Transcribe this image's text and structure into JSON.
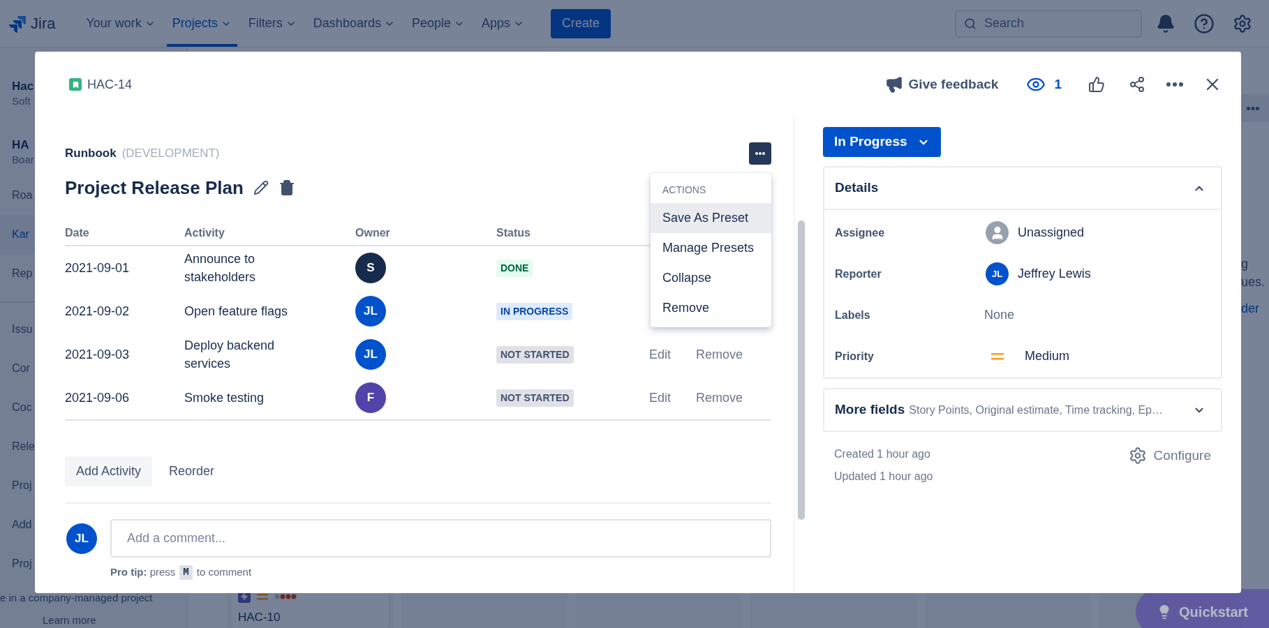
{
  "nav": {
    "logo": "Jira",
    "items": [
      {
        "label": "Your work",
        "selected": false
      },
      {
        "label": "Projects",
        "selected": true
      },
      {
        "label": "Filters",
        "selected": false
      },
      {
        "label": "Dashboards",
        "selected": false
      },
      {
        "label": "People",
        "selected": false
      },
      {
        "label": "Apps",
        "selected": false
      }
    ],
    "create": "Create",
    "search": {
      "placeholder": "Search"
    }
  },
  "sidebar": {
    "project": {
      "name": "Hac",
      "type": "Soft"
    },
    "board": {
      "name": "HA",
      "type": "Boar"
    },
    "items": [
      {
        "label": "Roa",
        "selected": false
      },
      {
        "label": "Kar",
        "selected": true
      },
      {
        "label": "Rep",
        "selected": false
      }
    ],
    "more_items": [
      "Issu",
      "Cor",
      "Coc",
      "Rele",
      "Proj",
      "Add",
      "Proj"
    ],
    "footer": "e in a company-managed project",
    "learn_more": "Learn more"
  },
  "board": {
    "card_key": "HAC-10",
    "right_texts": [
      "g",
      "ues."
    ],
    "right_link": "der"
  },
  "quickstart": "Quickstart",
  "issue": {
    "key": "HAC-14",
    "feedback": "Give feedback",
    "watchers": "1",
    "runbook": {
      "label": "Runbook",
      "environment": "(DEVELOPMENT)",
      "title": "Project Release Plan",
      "columns": [
        "Date",
        "Activity",
        "Owner",
        "Status"
      ],
      "rows": [
        {
          "date": "2021-09-01",
          "activity": "Announce to stakeholders",
          "owner": {
            "initials": "S",
            "color": "#172b4d"
          },
          "status": {
            "label": "DONE",
            "kind": "done"
          }
        },
        {
          "date": "2021-09-02",
          "activity": "Open feature flags",
          "owner": {
            "initials": "JL",
            "color": "#0052cc"
          },
          "status": {
            "label": "IN PROGRESS",
            "kind": "in_progress"
          }
        },
        {
          "date": "2021-09-03",
          "activity": "Deploy backend services",
          "owner": {
            "initials": "JL",
            "color": "#0052cc"
          },
          "status": {
            "label": "NOT STARTED",
            "kind": "not_started"
          },
          "actions": [
            "Edit",
            "Remove"
          ]
        },
        {
          "date": "2021-09-06",
          "activity": "Smoke testing",
          "owner": {
            "initials": "F",
            "color": "#5243aa"
          },
          "status": {
            "label": "NOT STARTED",
            "kind": "not_started"
          },
          "actions": [
            "Edit",
            "Remove"
          ]
        }
      ],
      "menu": {
        "heading": "ACTIONS",
        "items": [
          {
            "label": "Save As Preset",
            "selected": true
          },
          {
            "label": "Manage Presets",
            "selected": false
          },
          {
            "label": "Collapse",
            "selected": false
          },
          {
            "label": "Remove",
            "selected": false
          }
        ]
      },
      "buttons": [
        "Add Activity",
        "Reorder"
      ]
    },
    "comment": {
      "initials": "JL",
      "placeholder": "Add a comment...",
      "tip": "**Pro tip:** press",
      "key": "M",
      "tip_after": "to comment"
    },
    "status_button": "In Progress",
    "details": {
      "title": "Details",
      "expanded": true,
      "fields": [
        {
          "label": "Assignee",
          "value": "Unassigned",
          "kind": "unassigned"
        },
        {
          "label": "Reporter",
          "value": "Jeffrey Lewis",
          "kind": "user",
          "initials": "JL"
        },
        {
          "label": "Labels",
          "value": "None",
          "kind": "empty"
        },
        {
          "label": "Priority",
          "value": "Medium",
          "kind": "priority"
        }
      ]
    },
    "more_fields": {
      "title": "More fields",
      "summary": "Story Points, Original estimate, Time tracking, Ep…",
      "expanded": false
    },
    "created": "Created 1 hour ago",
    "updated": "Updated 1 hour ago",
    "configure": "Configure"
  }
}
